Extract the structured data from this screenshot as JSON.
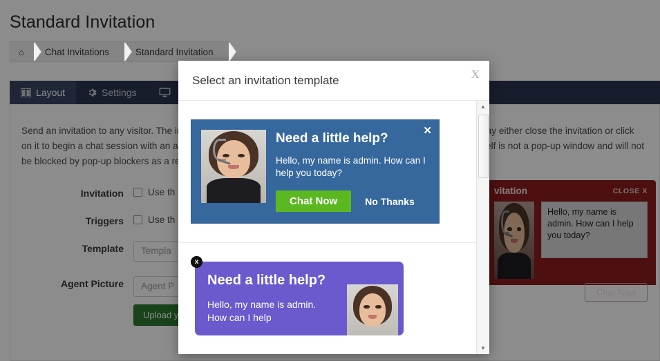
{
  "page": {
    "title": "Standard Invitation"
  },
  "breadcrumb": {
    "home_icon": "home-icon",
    "items": [
      {
        "label": "Chat Invitations"
      },
      {
        "label": "Standard Invitation"
      }
    ]
  },
  "tabs": [
    {
      "label": "Layout",
      "icon": "layout-columns-icon",
      "active": true
    },
    {
      "label": "Settings",
      "icon": "gear-icon",
      "active": false
    },
    {
      "label": "",
      "icon": "monitor-icon",
      "active": false
    }
  ],
  "panel": {
    "description": "Send an invitation to any visitor. The invitation is a layered graphic that has a chance of appearing. The visitor may either close the invitation or click on it to begin a chat session with an agent. The default invitation is the standard layered graphic. The layered itself is not a pop-up window and will not be blocked by pop-up blockers as a result. For the best results use the standard invitation on your web sites."
  },
  "form": {
    "rows": [
      {
        "label": "Invitation",
        "type": "checkbox",
        "checkbox_label": "Use th",
        "checked": false
      },
      {
        "label": "Triggers",
        "type": "checkbox",
        "checkbox_label": "Use th",
        "checked": false
      },
      {
        "label": "Template",
        "type": "input",
        "value": "Templa"
      },
      {
        "label": "Agent Picture",
        "type": "input",
        "value": "Agent P",
        "button_label": "Upload yo"
      }
    ]
  },
  "red_widget": {
    "title": "vitation",
    "close_label": "CLOSE X",
    "message": "Hello, my name is admin. How can I help you today?",
    "button_label": "Chat Now",
    "color": "#8c1d1d"
  },
  "modal": {
    "title": "Select an invitation template",
    "close_label": "X",
    "templates": [
      {
        "id": "blue-standard",
        "heading": "Need a little help?",
        "body": "Hello, my name is admin. How can I help you today?",
        "primary_button": "Chat Now",
        "secondary_button": "No Thanks",
        "close_glyph": "✕",
        "bg_color": "#36689e",
        "button_color": "#5cb821"
      },
      {
        "id": "purple-rounded",
        "heading": "Need a little help?",
        "body": "Hello, my name is admin. How can I help",
        "badge_glyph": "x",
        "bg_color": "#6a5acd"
      }
    ],
    "scrollbar": {
      "up_arrow": "▲",
      "down_arrow": "▼"
    }
  }
}
